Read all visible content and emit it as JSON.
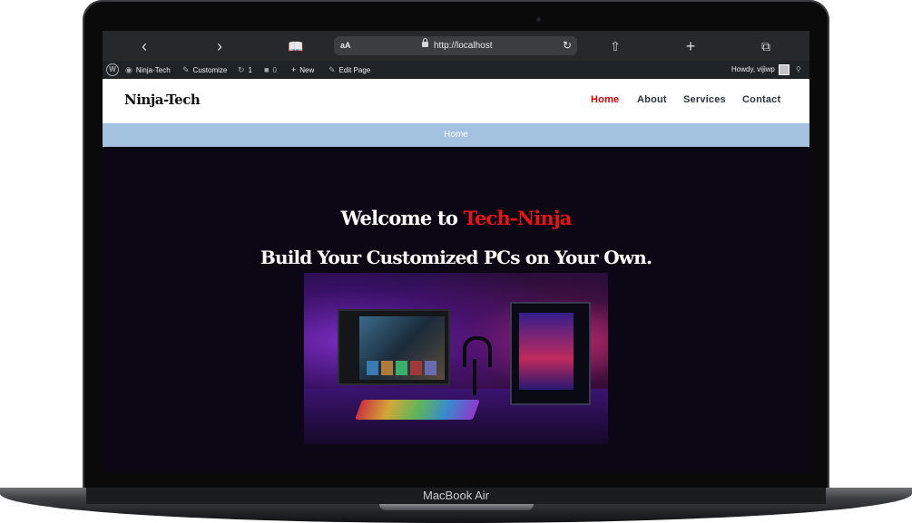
{
  "device": {
    "label": "MacBook Air"
  },
  "browser": {
    "url_prefix": "aA",
    "url": "http://localhost",
    "icons": [
      "back-icon",
      "forward-icon",
      "reader-icon",
      "reload-icon",
      "share-icon",
      "new-tab-icon",
      "tabs-icon"
    ]
  },
  "wp_admin_bar": {
    "site_name": "Ninja-Tech",
    "customize": "Customize",
    "updates_count": "1",
    "comments_count": "0",
    "new": "New",
    "edit_page": "Edit Page",
    "howdy": "Howdy, vijiwp"
  },
  "site": {
    "logo": "Ninja-Tech",
    "nav": [
      {
        "label": "Home",
        "active": true
      },
      {
        "label": "About",
        "active": false
      },
      {
        "label": "Services",
        "active": false
      },
      {
        "label": "Contact",
        "active": false
      }
    ],
    "breadcrumb": "Home"
  },
  "hero": {
    "welcome_prefix": "Welcome to ",
    "welcome_brand": "Tech-Ninja",
    "tagline": "Build Your Customized PCs on Your Own."
  },
  "colors": {
    "accent": "#e00000",
    "breadcrumb_bg": "#a3c2e0",
    "hero_bg": "#0c0714",
    "wp_bar_bg": "#1d2327"
  }
}
